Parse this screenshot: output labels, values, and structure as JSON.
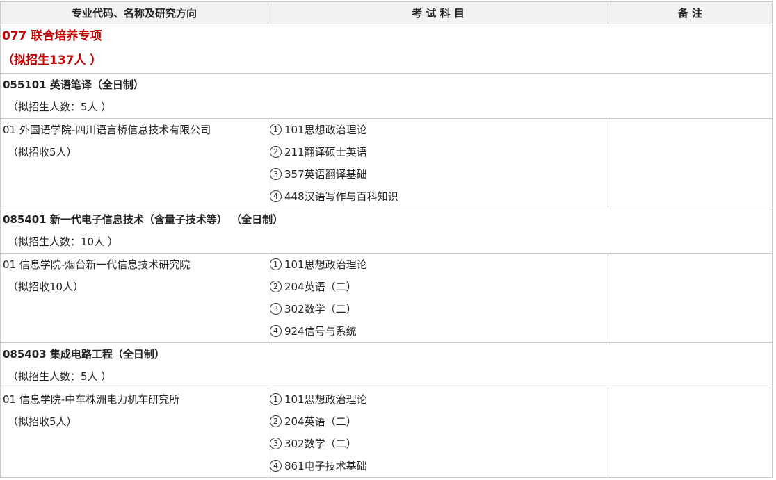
{
  "headers": [
    "专业代码、名称及研究方向",
    "考 试 科 目",
    "备 注"
  ],
  "program": {
    "title": "077 联合培养专项",
    "quota": "（拟招生137人 ）"
  },
  "majors": [
    {
      "title": "055101 英语笔译（全日制）",
      "quota": "（拟招生人数：5人 ）",
      "direction": "01 外国语学院-四川语言桥信息技术有限公司",
      "direction_quota": "（拟招收5人）",
      "subjects": [
        {
          "num": "1",
          "text": "101思想政治理论"
        },
        {
          "num": "2",
          "text": "211翻译硕士英语"
        },
        {
          "num": "3",
          "text": "357英语翻译基础"
        },
        {
          "num": "4",
          "text": "448汉语写作与百科知识"
        }
      ]
    },
    {
      "title": "085401 新一代电子信息技术（含量子技术等） （全日制）",
      "quota": "（拟招生人数：10人 ）",
      "direction": "01 信息学院-烟台新一代信息技术研究院",
      "direction_quota": "（拟招收10人）",
      "subjects": [
        {
          "num": "1",
          "text": "101思想政治理论"
        },
        {
          "num": "2",
          "text": "204英语（二）"
        },
        {
          "num": "3",
          "text": "302数学（二）"
        },
        {
          "num": "4",
          "text": "924信号与系统"
        }
      ]
    },
    {
      "title": "085403 集成电路工程（全日制）",
      "quota": "（拟招生人数：5人 ）",
      "direction": "01 信息学院-中车株洲电力机车研究所",
      "direction_quota": "（拟招收5人）",
      "subjects": [
        {
          "num": "1",
          "text": "101思想政治理论"
        },
        {
          "num": "2",
          "text": "204英语（二）"
        },
        {
          "num": "3",
          "text": "302数学（二）"
        },
        {
          "num": "4",
          "text": "861电子技术基础"
        }
      ]
    }
  ]
}
